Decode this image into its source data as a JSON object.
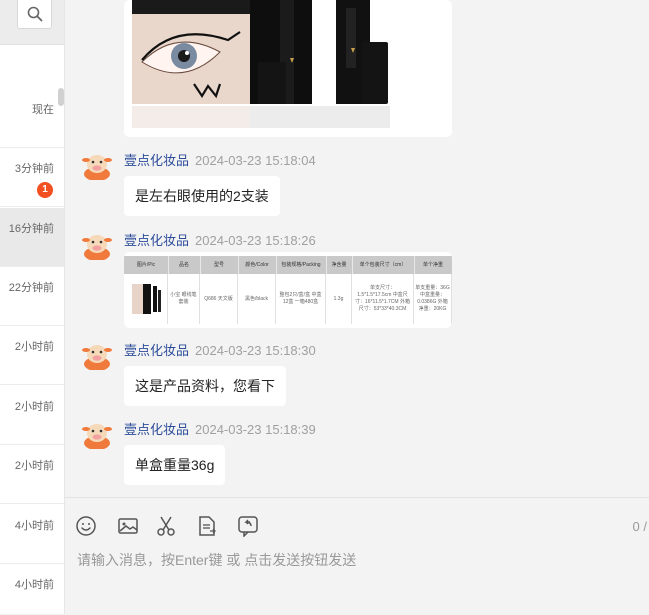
{
  "sidebar": {
    "conversations": [
      {
        "time": "现在",
        "badge": ""
      },
      {
        "time": "3分钟前",
        "badge": "1"
      },
      {
        "time": "16分钟前",
        "badge": ""
      },
      {
        "time": "22分钟前",
        "badge": ""
      },
      {
        "time": "2小时前",
        "badge": ""
      },
      {
        "time": "2小时前",
        "badge": ""
      },
      {
        "time": "2小时前",
        "badge": ""
      },
      {
        "time": "4小时前",
        "badge": ""
      },
      {
        "time": "4小时前",
        "badge": ""
      }
    ]
  },
  "messages": [
    {
      "sender": "壹点化妆品",
      "time": "2024-03-23 15:18:04",
      "text": "是左右眼使用的2支装"
    },
    {
      "sender": "壹点化妆品",
      "time": "2024-03-23 15:18:26",
      "text": ""
    },
    {
      "sender": "壹点化妆品",
      "time": "2024-03-23 15:18:30",
      "text": "这是产品资料，您看下"
    },
    {
      "sender": "壹点化妆品",
      "time": "2024-03-23 15:18:39",
      "text": "单盒重量36g"
    }
  ],
  "product_table": {
    "headers": [
      "图片/Pic",
      "品名",
      "型号",
      "颜色/Color",
      "包装规格/Packing",
      "净含量",
      "单个包装尺寸（cm）",
      "单个净重"
    ],
    "row": [
      "",
      "小宝 眼线笔 套装",
      "Q686 天文版",
      "黑色/black",
      "整包2只/盒/盒 中盒12盒 一箱480盒",
      "1.3g",
      "单支尺寸：1.5*1.5*17.5cm 中盒尺寸：16*11.5*1.7CM 外箱尺寸：53*33*40.3CM",
      "单支重量：36G 中盒重量：0.0386G 外箱净重：20KG"
    ]
  },
  "composer": {
    "placeholder": "请输入消息，按Enter键 或 点击发送按钮发送",
    "counter": "0 /"
  },
  "colors": {
    "sender": "#2c4c9a",
    "badge": "#f25022",
    "timestamp": "#a0a0a0"
  },
  "icons": {
    "search": "search-icon",
    "emoji": "smiley-icon",
    "image": "image-icon",
    "cut": "scissors-icon",
    "doc": "document-icon",
    "recall": "recall-icon"
  }
}
